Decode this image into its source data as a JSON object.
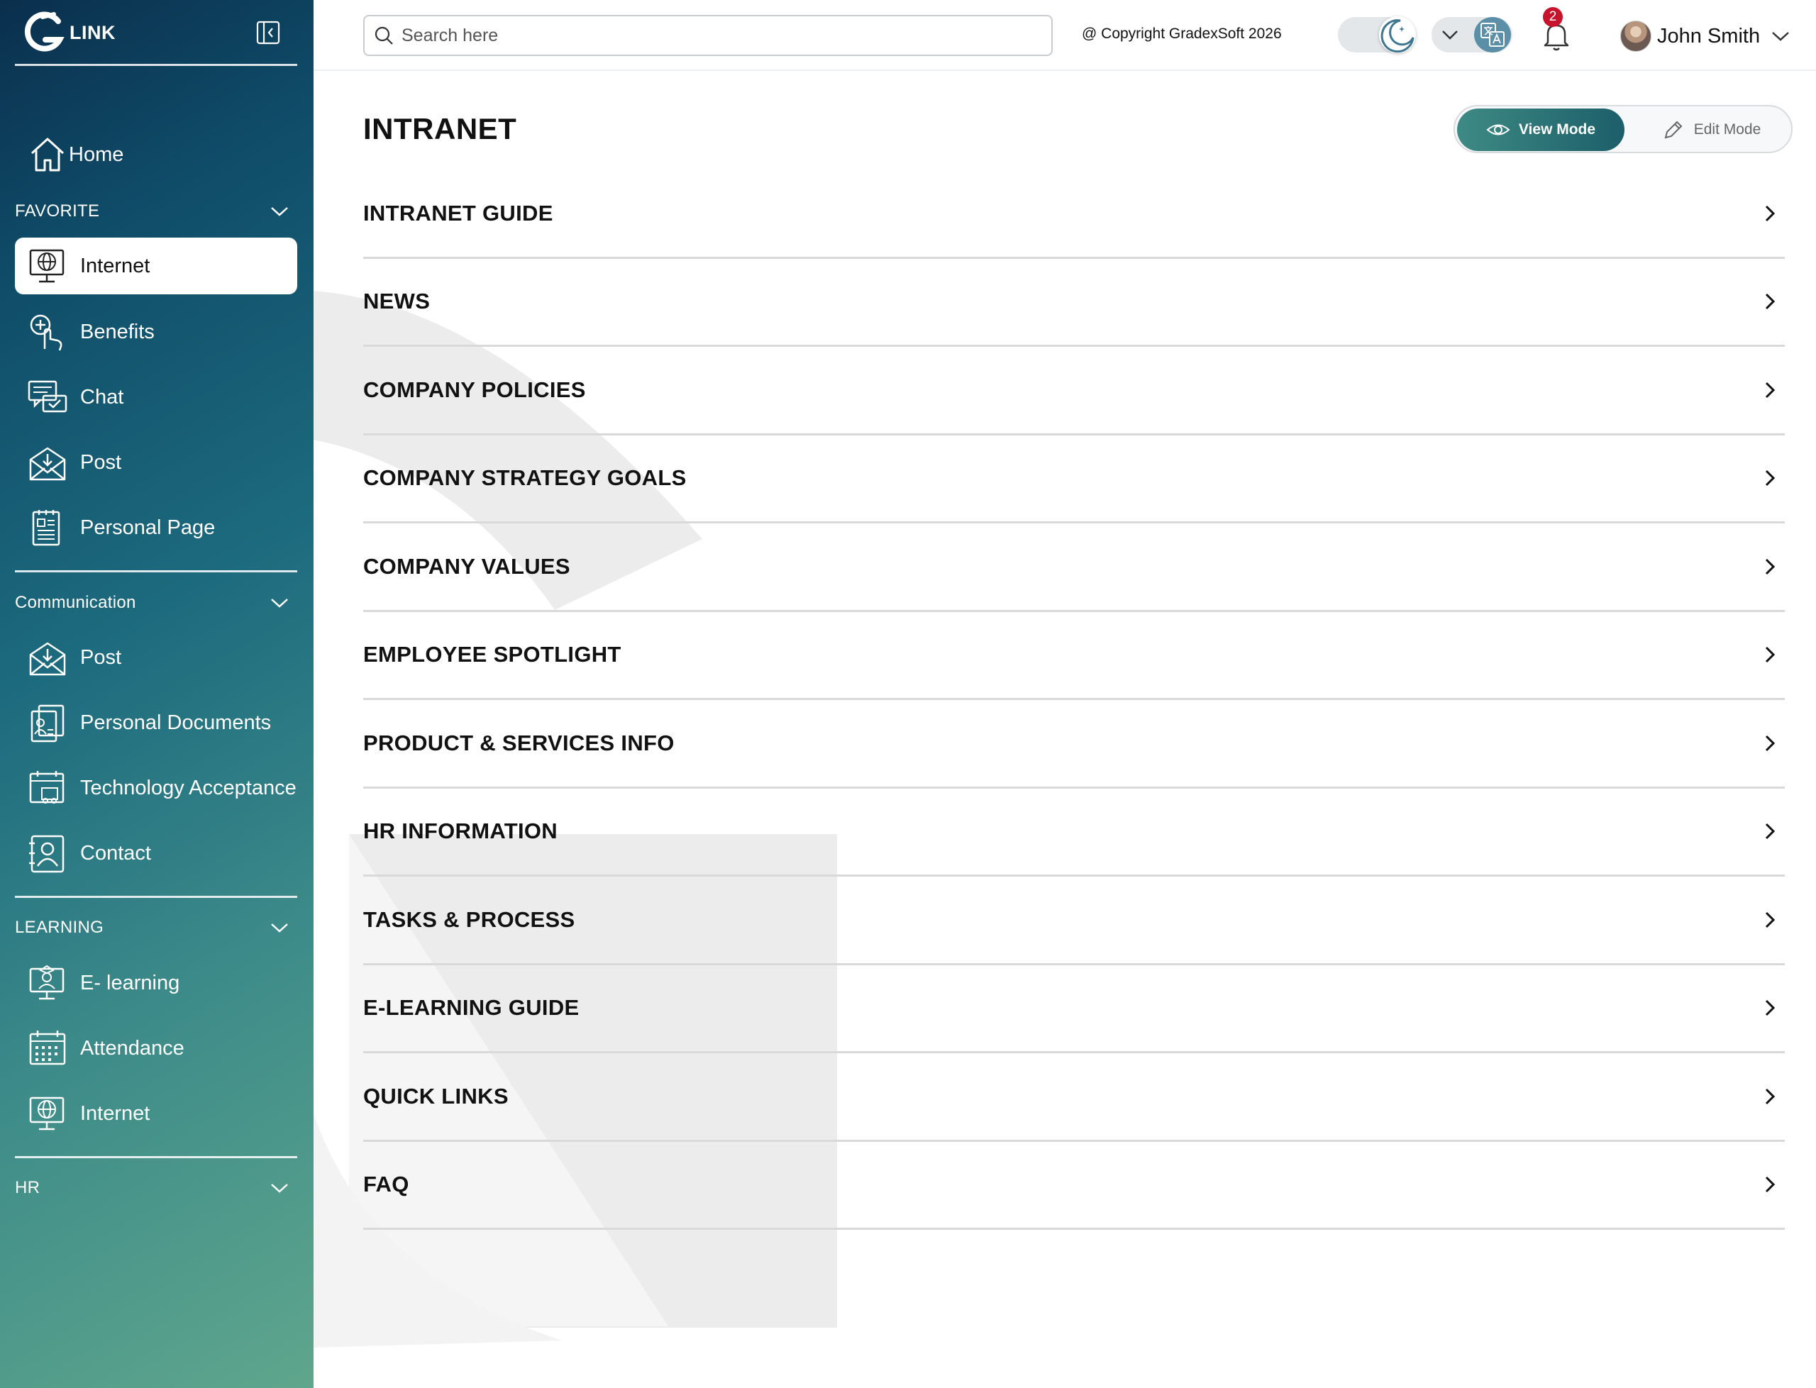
{
  "brand": {
    "text": "LINK"
  },
  "sidebar": {
    "home": {
      "label": "Home"
    },
    "sections": [
      {
        "title": "FAVORITE",
        "items": [
          {
            "label": "Internet",
            "icon": "globe-monitor-icon",
            "active": true
          },
          {
            "label": "Benefits",
            "icon": "hand-click-icon"
          },
          {
            "label": "Chat",
            "icon": "chat-icon"
          },
          {
            "label": "Post",
            "icon": "mail-inbox-icon"
          },
          {
            "label": "Personal Page",
            "icon": "document-icon"
          }
        ]
      },
      {
        "title": "Communication",
        "items": [
          {
            "label": "Post",
            "icon": "mail-inbox-icon"
          },
          {
            "label": "Personal Documents",
            "icon": "id-document-icon"
          },
          {
            "label": "Technology Acceptance",
            "icon": "calendar-truck-icon"
          },
          {
            "label": "Contact",
            "icon": "contact-icon"
          }
        ]
      },
      {
        "title": "LEARNING",
        "items": [
          {
            "label": "E- learning",
            "icon": "elearning-icon"
          },
          {
            "label": "Attendance",
            "icon": "calendar-icon"
          },
          {
            "label": "Internet",
            "icon": "globe-monitor-icon"
          }
        ]
      },
      {
        "title": "HR",
        "items": []
      }
    ]
  },
  "topbar": {
    "search_placeholder": "Search here",
    "copyright": "@ Copyright GradexSoft 2026",
    "notification_count": "2",
    "user_name": "John Smith"
  },
  "page": {
    "title": "INTRANET",
    "view_mode_label": "View Mode",
    "edit_mode_label": "Edit Mode",
    "sections": [
      "INTRANET GUIDE",
      "NEWS",
      "COMPANY POLICIES",
      "COMPANY STRATEGY GOALS",
      "COMPANY VALUES",
      "EMPLOYEE SPOTLIGHT",
      "PRODUCT & SERVICES INFO",
      "HR INFORMATION",
      "TASKS & PROCESS",
      "E-LEARNING GUIDE",
      "QUICK LINKS",
      "FAQ"
    ]
  },
  "colors": {
    "sidebar_top": "#0a2f4d",
    "sidebar_bottom": "#5fa68c",
    "view_mode_bg": "#1c5e6a",
    "badge": "#c7132b",
    "divider": "#d9d9d9"
  }
}
